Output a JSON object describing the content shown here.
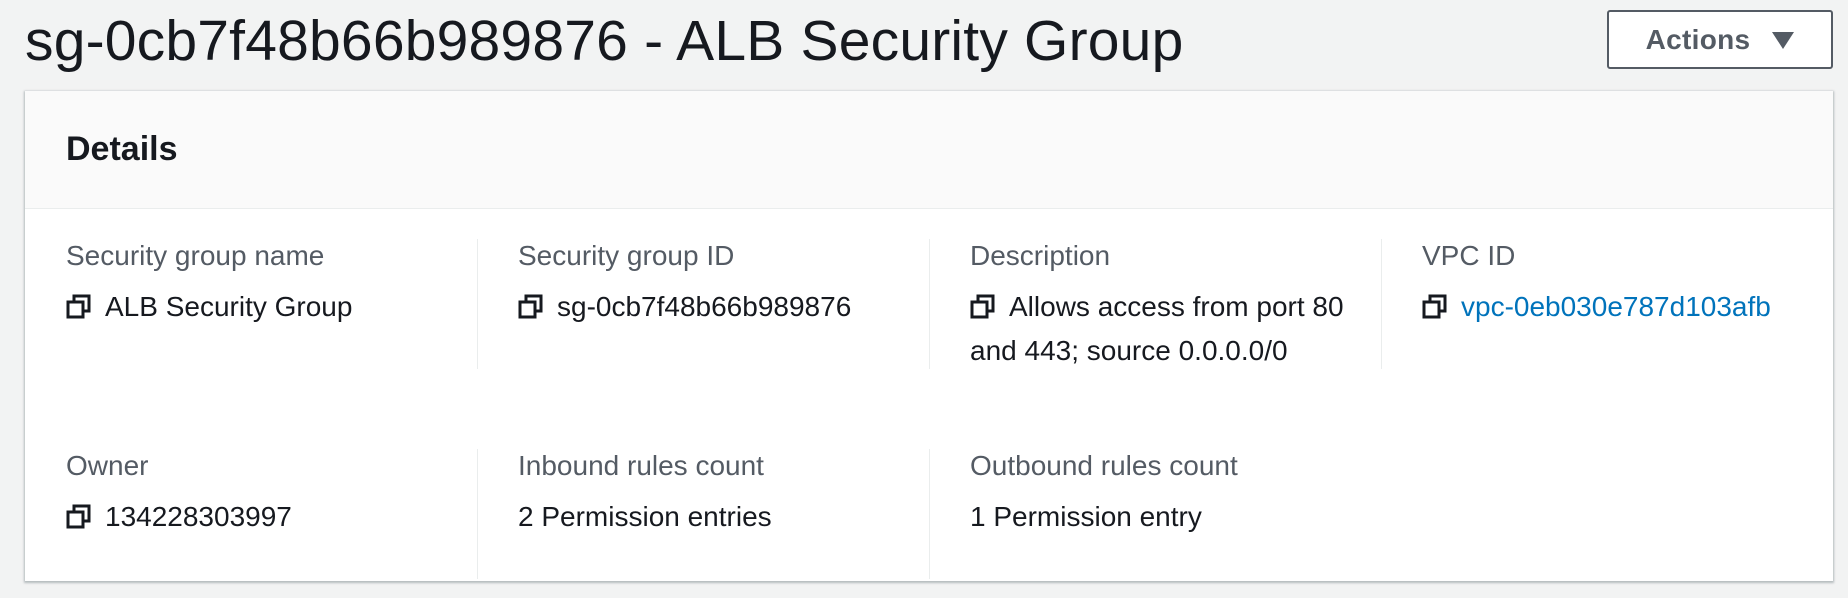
{
  "header": {
    "title": "sg-0cb7f48b66b989876 - ALB Security Group",
    "actions_label": "Actions"
  },
  "details": {
    "title": "Details",
    "security_group_name": {
      "label": "Security group name",
      "value": "ALB Security Group"
    },
    "security_group_id": {
      "label": "Security group ID",
      "value": "sg-0cb7f48b66b989876"
    },
    "description": {
      "label": "Description",
      "value": "Allows access from port 80 and 443; source 0.0.0.0/0"
    },
    "vpc_id": {
      "label": "VPC ID",
      "value": "vpc-0eb030e787d103afb"
    },
    "owner": {
      "label": "Owner",
      "value": "134228303997"
    },
    "inbound_rules_count": {
      "label": "Inbound rules count",
      "value": "2 Permission entries"
    },
    "outbound_rules_count": {
      "label": "Outbound rules count",
      "value": "1 Permission entry"
    }
  },
  "colors": {
    "link": "#0073bb",
    "text": "#16191f",
    "label": "#545b64",
    "background": "#f2f3f3"
  },
  "icons": {
    "copy": "copy-icon",
    "dropdown": "caret-down-icon"
  }
}
